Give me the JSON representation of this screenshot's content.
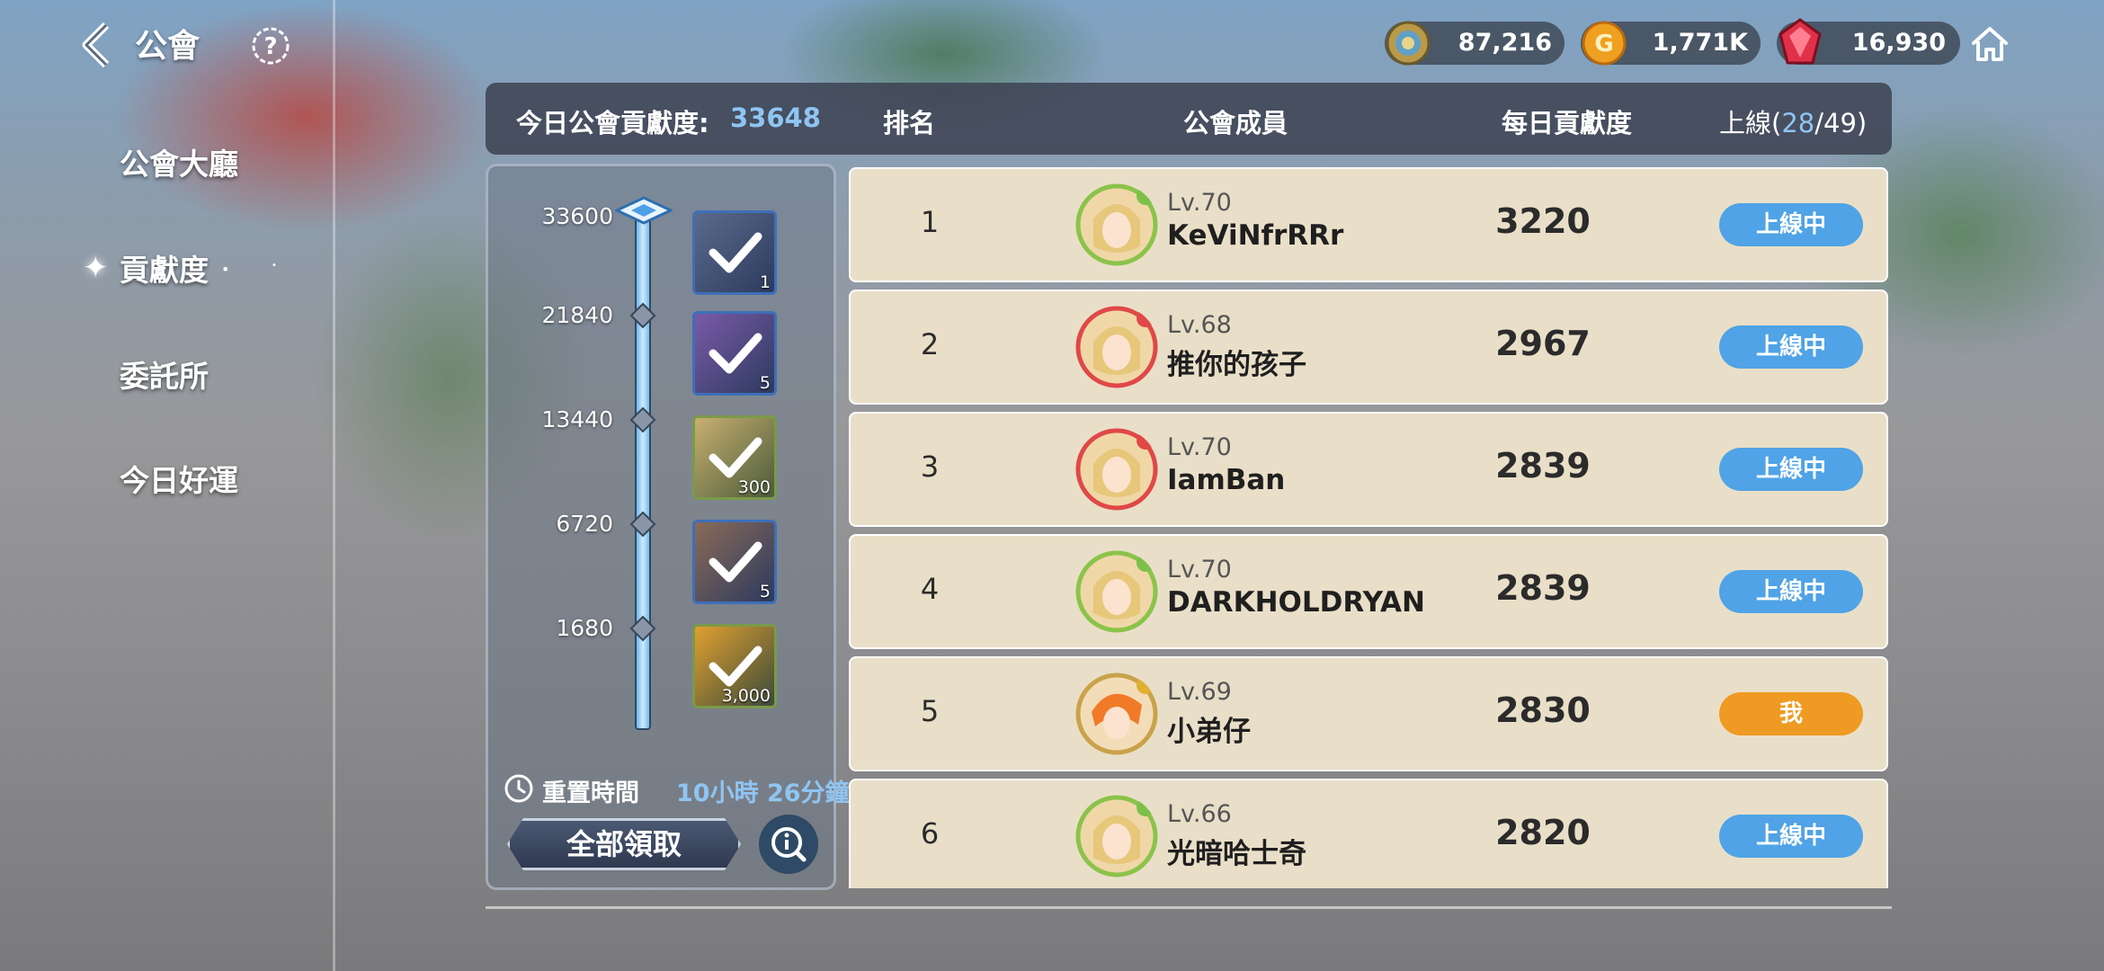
{
  "app": {
    "title": "公會"
  },
  "sidebar": {
    "items": [
      {
        "label": "公會大廳",
        "active": false
      },
      {
        "label": "貢獻度",
        "active": true
      },
      {
        "label": "委託所",
        "active": false
      },
      {
        "label": "今日好運",
        "active": false
      }
    ]
  },
  "currency": [
    {
      "icon": "gold-medal-icon",
      "value": "87,216"
    },
    {
      "icon": "gold-coin-icon",
      "value": "1,771K"
    },
    {
      "icon": "red-gem-icon",
      "value": "16,930"
    }
  ],
  "header": {
    "today_label": "今日公會貢獻度:",
    "today_value": "33648",
    "rank_label": "排名",
    "member_label": "公會成員",
    "daily_label": "每日貢獻度",
    "online_prefix": "上線(",
    "online_count": "28",
    "online_total": "/49)"
  },
  "milestones": [
    {
      "value": "33600",
      "reward_qty": "1",
      "claimed": true
    },
    {
      "value": "21840",
      "reward_qty": "5",
      "claimed": true
    },
    {
      "value": "13440",
      "reward_qty": "300",
      "claimed": true
    },
    {
      "value": "6720",
      "reward_qty": "5",
      "claimed": true
    },
    {
      "value": "1680",
      "reward_qty": "3,000",
      "claimed": true
    }
  ],
  "reset": {
    "label": "重置時間",
    "time": "10小時 26分鐘"
  },
  "claim_all_label": "全部領取",
  "members": [
    {
      "rank": "1",
      "level": "Lv.70",
      "name": "KeViNfrRRr",
      "contribution": "3220",
      "status": "上線中",
      "is_me": false
    },
    {
      "rank": "2",
      "level": "Lv.68",
      "name": "推你的孩子",
      "contribution": "2967",
      "status": "上線中",
      "is_me": false
    },
    {
      "rank": "3",
      "level": "Lv.70",
      "name": "IamBan",
      "contribution": "2839",
      "status": "上線中",
      "is_me": false
    },
    {
      "rank": "4",
      "level": "Lv.70",
      "name": "DARKHOLDRYAN",
      "contribution": "2839",
      "status": "上線中",
      "is_me": false
    },
    {
      "rank": "5",
      "level": "Lv.69",
      "name": "小弟仔",
      "contribution": "2830",
      "status": "我",
      "is_me": true
    },
    {
      "rank": "6",
      "level": "Lv.66",
      "name": "光暗哈士奇",
      "contribution": "2820",
      "status": "上線中",
      "is_me": false
    }
  ],
  "colors": {
    "online_badge": "#4fa3e6",
    "me_badge": "#ef9a22",
    "accent_blue": "#8fc5f2",
    "row_bg": "#e9dfc8"
  }
}
